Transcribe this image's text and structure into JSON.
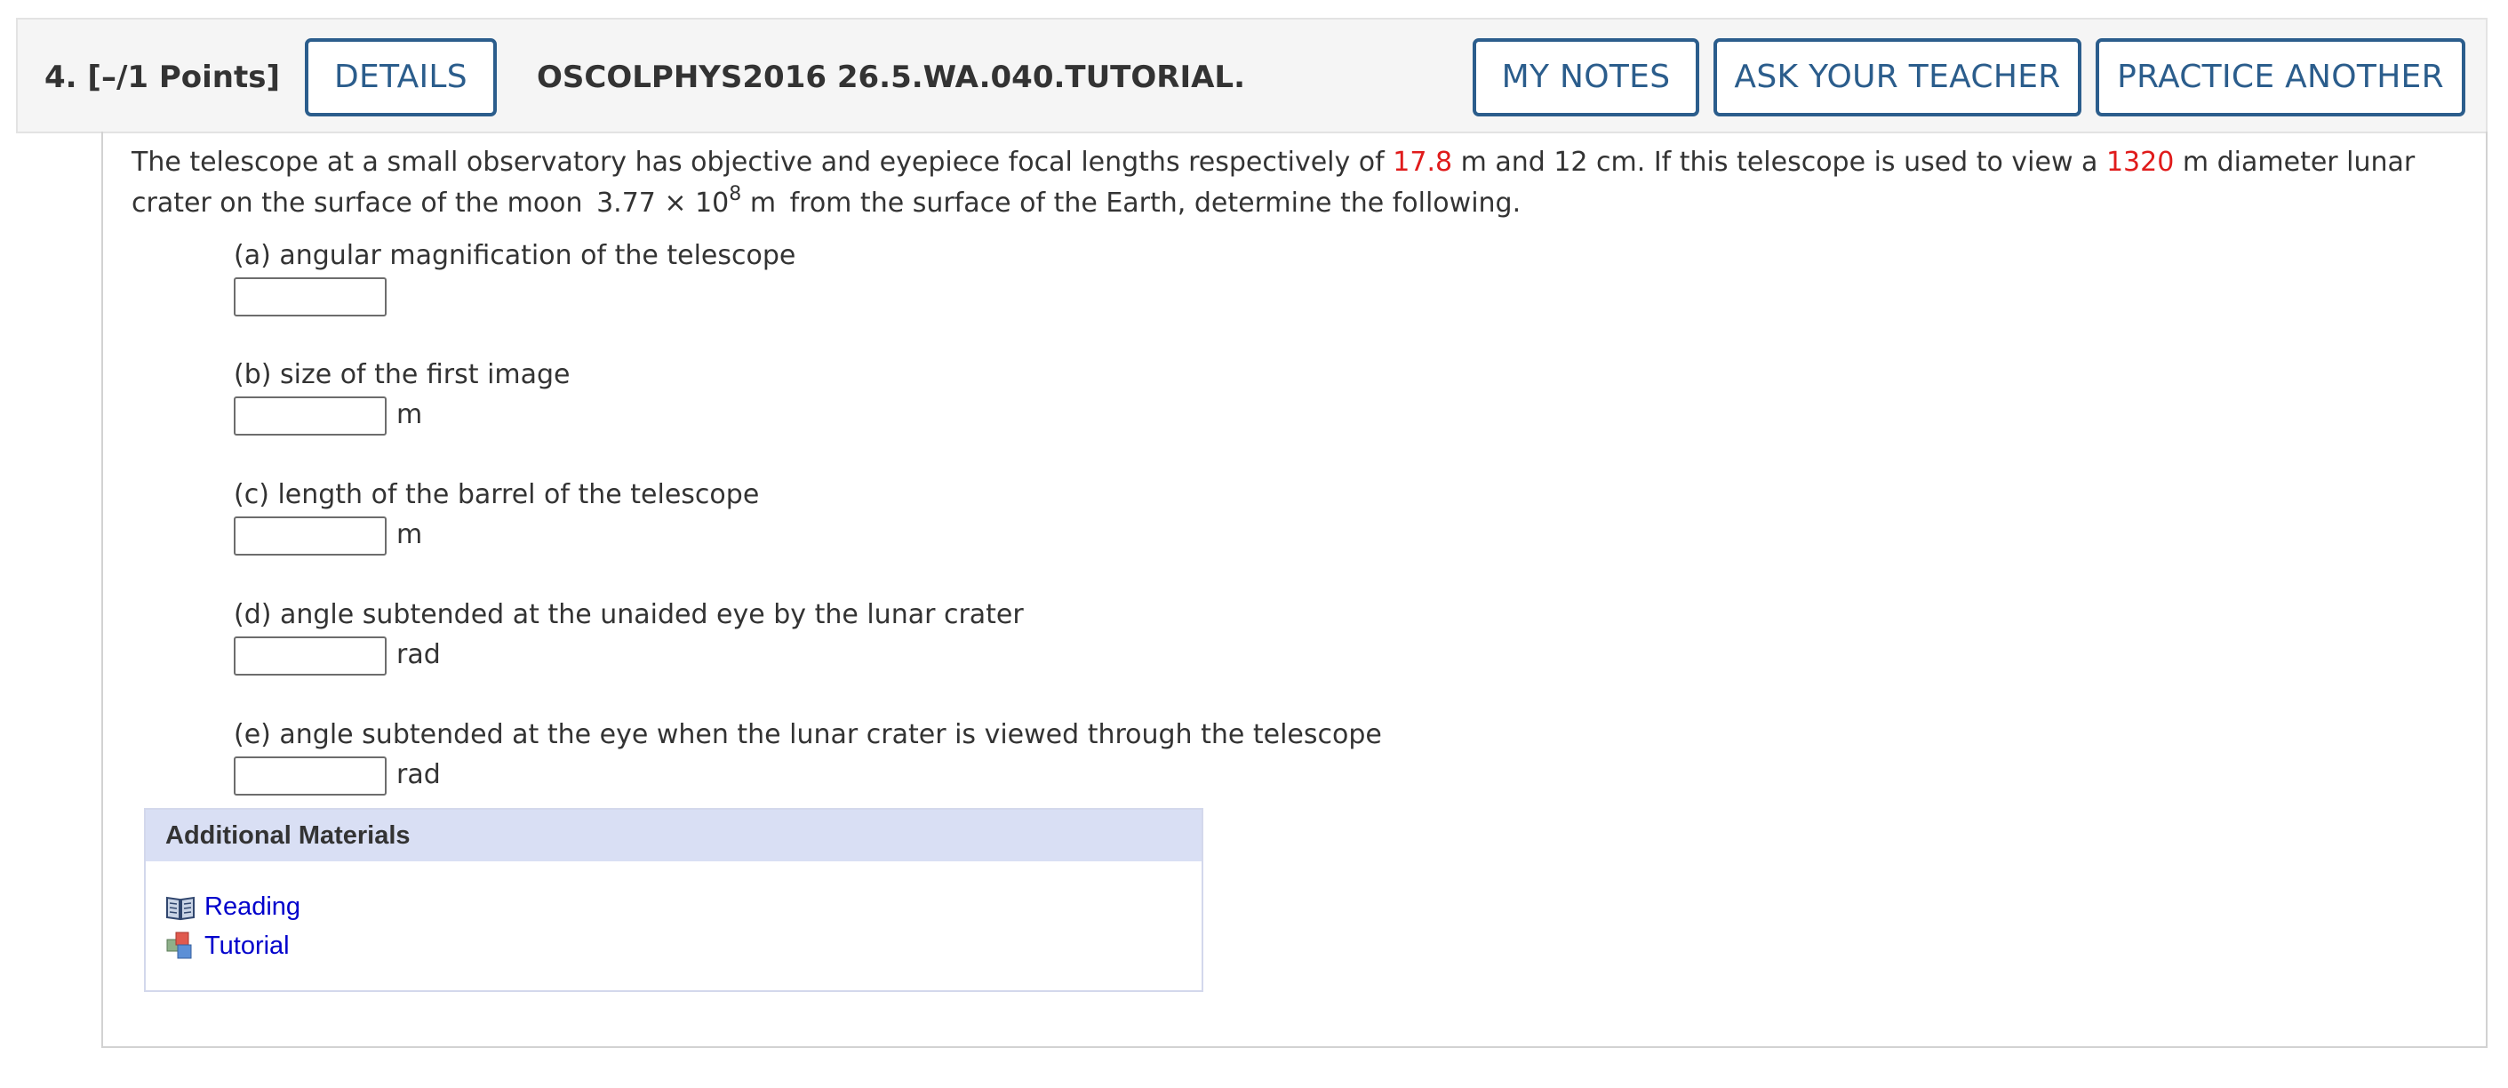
{
  "header": {
    "question_number": "4.",
    "points": "[–/1 Points]",
    "details_label": "DETAILS",
    "question_code": "OSCOLPHYS2016 26.5.WA.040.TUTORIAL.",
    "my_notes_label": "MY NOTES",
    "ask_teacher_label": "ASK YOUR TEACHER",
    "practice_another_label": "PRACTICE ANOTHER"
  },
  "problem": {
    "text_1": "The telescope at a small observatory has objective and eyepiece focal lengths respectively of ",
    "objective_focal": "17.8",
    "text_2": " m and 12 cm. If this telescope is used to view a ",
    "crater_diameter": "1320",
    "text_3": " m diameter lunar crater on the surface of the moon ",
    "distance_mantissa": "3.77 × 10",
    "distance_exponent": "8",
    "distance_unit": " m",
    "text_4": " from the surface of the Earth, determine the following."
  },
  "parts": [
    {
      "label": "(a) angular magnification of the telescope",
      "unit": "",
      "value": ""
    },
    {
      "label": "(b) size of the first image",
      "unit": "m",
      "value": ""
    },
    {
      "label": "(c) length of the barrel of the telescope",
      "unit": "m",
      "value": ""
    },
    {
      "label": "(d) angle subtended at the unaided eye by the lunar crater",
      "unit": "rad",
      "value": ""
    },
    {
      "label": "(e) angle subtended at the eye when the lunar crater is viewed through the telescope",
      "unit": "rad",
      "value": ""
    }
  ],
  "materials": {
    "title": "Additional Materials",
    "links": [
      {
        "label": "Reading",
        "icon": "book-icon"
      },
      {
        "label": "Tutorial",
        "icon": "cubes-icon"
      }
    ]
  },
  "colors": {
    "accent": "#2b5d8c",
    "highlight_red": "#e01b1b",
    "link_blue": "#0000cc",
    "materials_header_bg": "#d9dff4"
  }
}
